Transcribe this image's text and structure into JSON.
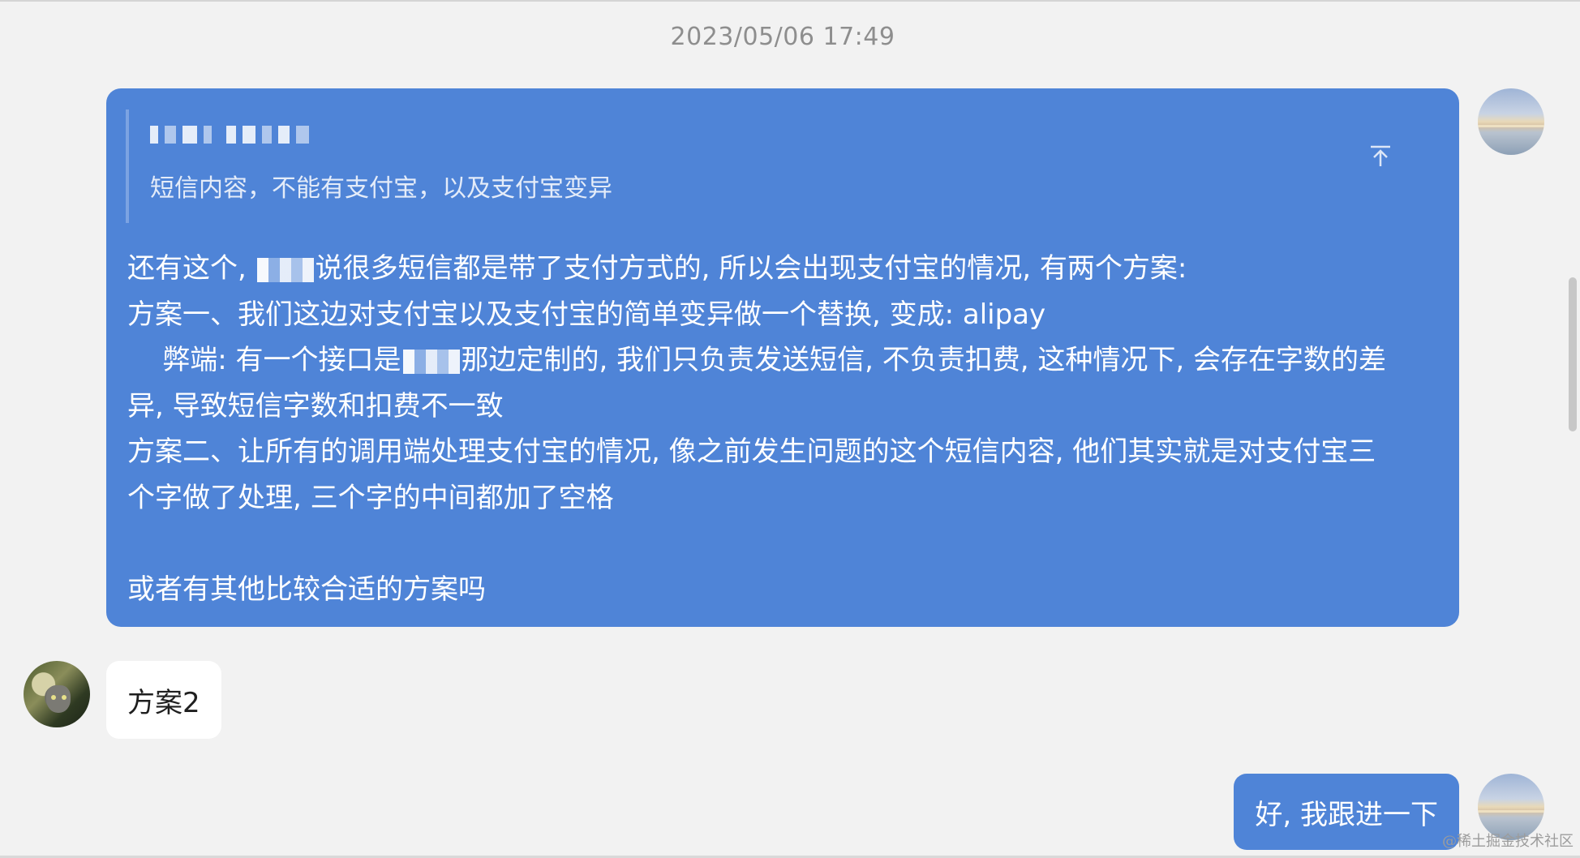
{
  "chat": {
    "timestamp": "2023/05/06 17:49",
    "messages": [
      {
        "direction": "outgoing",
        "quote": {
          "author_redacted": true,
          "text": "短信内容，不能有支付宝，以及支付宝变异"
        },
        "lines": [
          {
            "before": "还有这个, ",
            "after": "说很多短信都是带了支付方式的, 所以会出现支付宝的情况, 有两个方案:"
          },
          {
            "text": "方案一、我们这边对支付宝以及支付宝的简单变异做一个替换, 变成: alipay"
          },
          {
            "before": "    弊端: 有一个接口是",
            "after": "那边定制的, 我们只负责发送短信, 不负责扣费, 这种情况下, 会存在字数的差"
          },
          {
            "text": "异, 导致短信字数和扣费不一致"
          },
          {
            "text": "方案二、让所有的调用端处理支付宝的情况, 像之前发生问题的这个短信内容, 他们其实就是对支付宝三"
          },
          {
            "text": "个字做了处理, 三个字的中间都加了空格"
          },
          {
            "text": ""
          },
          {
            "text": "或者有其他比较合适的方案吗"
          }
        ]
      },
      {
        "direction": "incoming",
        "text": "方案2"
      },
      {
        "direction": "outgoing",
        "text": "好, 我跟进一下"
      }
    ]
  },
  "icons": {
    "pin": "pin-to-top-icon",
    "avatar_self": "sky-avatar",
    "avatar_other": "cat-avatar"
  },
  "colors": {
    "outgoing_bubble": "#4f84d7",
    "incoming_bubble": "#ffffff",
    "background": "#f2f2f2"
  },
  "watermark": "@稀土掘金技术社区"
}
